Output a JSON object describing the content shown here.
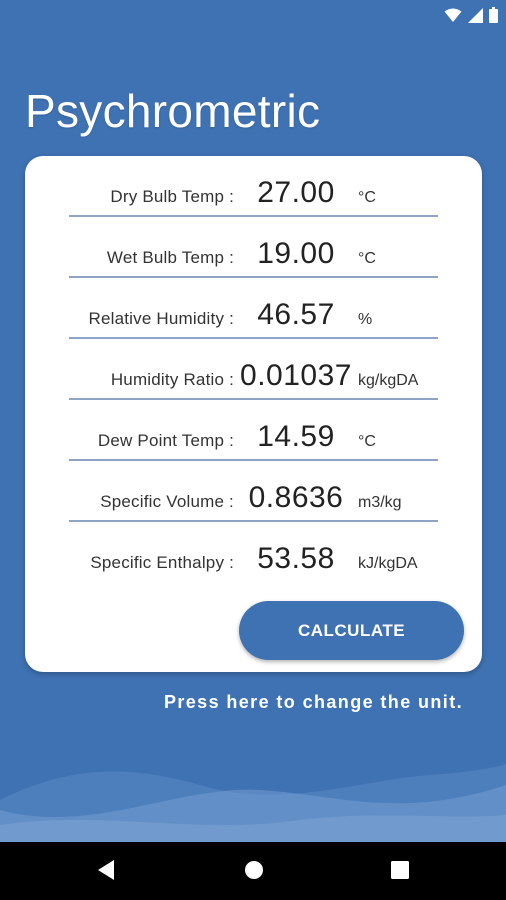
{
  "app": {
    "title": "Psychrometric"
  },
  "fields": [
    {
      "label": "Dry Bulb Temp :",
      "value": "27.00",
      "unit": "°C"
    },
    {
      "label": "Wet Bulb Temp :",
      "value": "19.00",
      "unit": "°C"
    },
    {
      "label": "Relative Humidity :",
      "value": "46.57",
      "unit": "%"
    },
    {
      "label": "Humidity Ratio :",
      "value": "0.01037",
      "unit": "kg/kgDA"
    },
    {
      "label": "Dew Point Temp :",
      "value": "14.59",
      "unit": "°C"
    },
    {
      "label": "Specific Volume :",
      "value": "0.8636",
      "unit": "m3/kg"
    },
    {
      "label": "Specific Enthalpy :",
      "value": "53.58",
      "unit": "kJ/kgDA"
    }
  ],
  "calculate_button": {
    "label": "CALCULATE"
  },
  "unit_hint": "Press here to change the unit.",
  "status_bar": {
    "icons": [
      "wifi-icon",
      "signal-icon",
      "battery-icon"
    ]
  },
  "nav_bar": {
    "icons": [
      "back-icon",
      "home-icon",
      "recents-icon"
    ]
  },
  "colors": {
    "background": "#3f72b3",
    "card": "#ffffff",
    "button": "#3f72b3",
    "underline": "#8fa4c4"
  }
}
